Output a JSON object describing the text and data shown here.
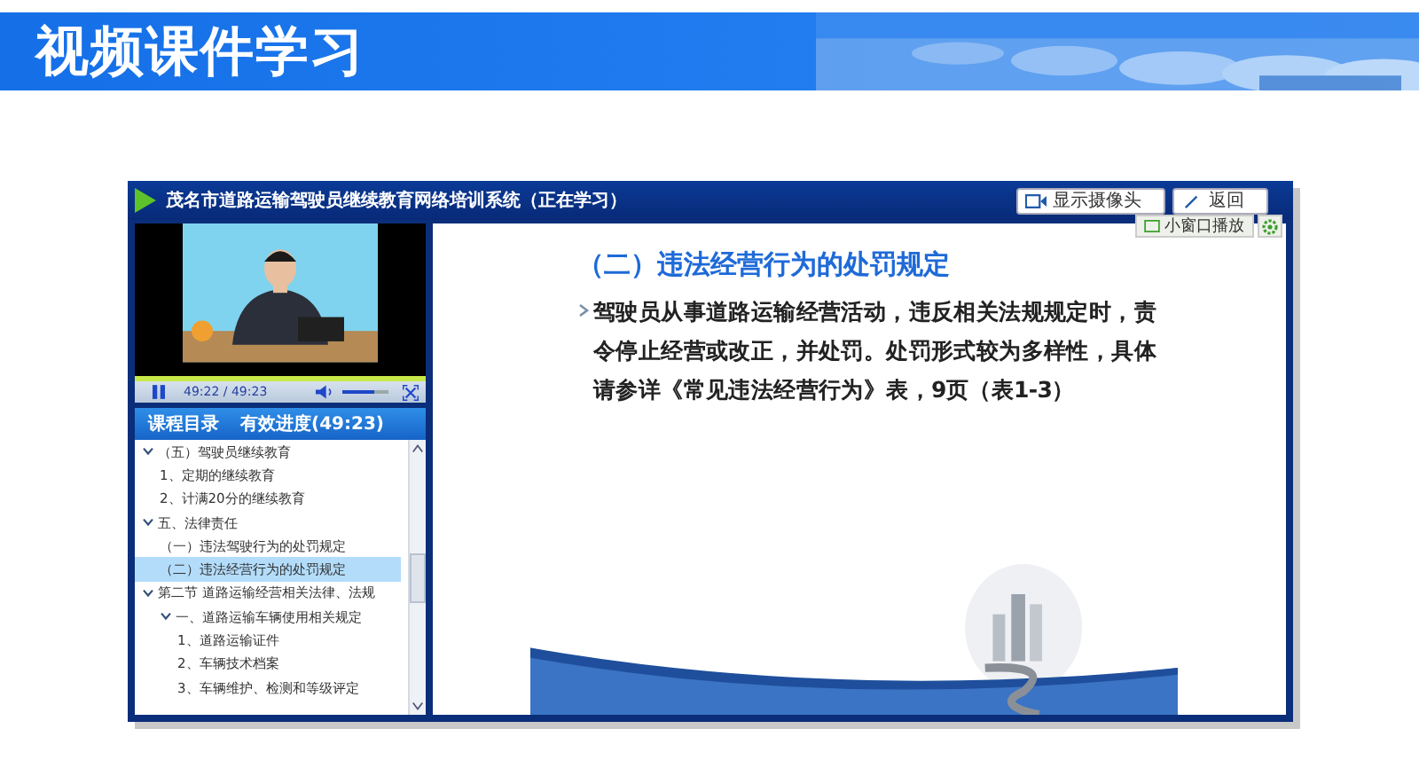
{
  "banner": {
    "title": "视频课件学习"
  },
  "app": {
    "title": "茂名市道路运输驾驶员继续教育网络培训系统（正在学习）",
    "buttons": [
      {
        "kind": "camera",
        "label": "显示摄像头"
      },
      {
        "kind": "back",
        "label": "返回"
      }
    ],
    "mini_player": {
      "label": "小窗口播放"
    }
  },
  "player": {
    "playing": true,
    "time": "49:22 / 49:23",
    "progress": {
      "level": 1
    },
    "volume": {
      "level": 0.7
    }
  },
  "toc": {
    "title": "课程目录",
    "progress_label": "有效进度(49:23)",
    "items": [
      {
        "label": "（五）驾驶员继续教育",
        "expanded": true,
        "selected": false,
        "children": [
          {
            "label": "1、定期的继续教育",
            "selected": false
          },
          {
            "label": "2、计满20分的继续教育",
            "selected": false
          }
        ]
      },
      {
        "label": "五、法律责任",
        "expanded": true,
        "selected": false,
        "children": [
          {
            "label": "（一）违法驾驶行为的处罚规定",
            "selected": false
          },
          {
            "label": "（二）违法经营行为的处罚规定",
            "selected": true
          }
        ]
      },
      {
        "label": "第二节 道路运输经营相关法律、法规",
        "expanded": true,
        "selected": false,
        "children": [
          {
            "label": "一、道路运输车辆使用相关规定",
            "expanded": true,
            "selected": false,
            "children": [
              {
                "label": "1、道路运输证件",
                "selected": false
              },
              {
                "label": "2、车辆技术档案",
                "selected": false
              },
              {
                "label": "3、车辆维护、检测和等级评定",
                "selected": false
              }
            ]
          }
        ]
      }
    ]
  },
  "slide": {
    "title": "（二）违法经营行为的处罚规定",
    "bullets": [
      "驾驶员从事道路运输经营活动，违反相关法规规定时，责令停止经营或改正，并处罚。处罚形式较为多样性，具体请参详《常见违法经营行为》表，9页（表1-3）"
    ]
  }
}
